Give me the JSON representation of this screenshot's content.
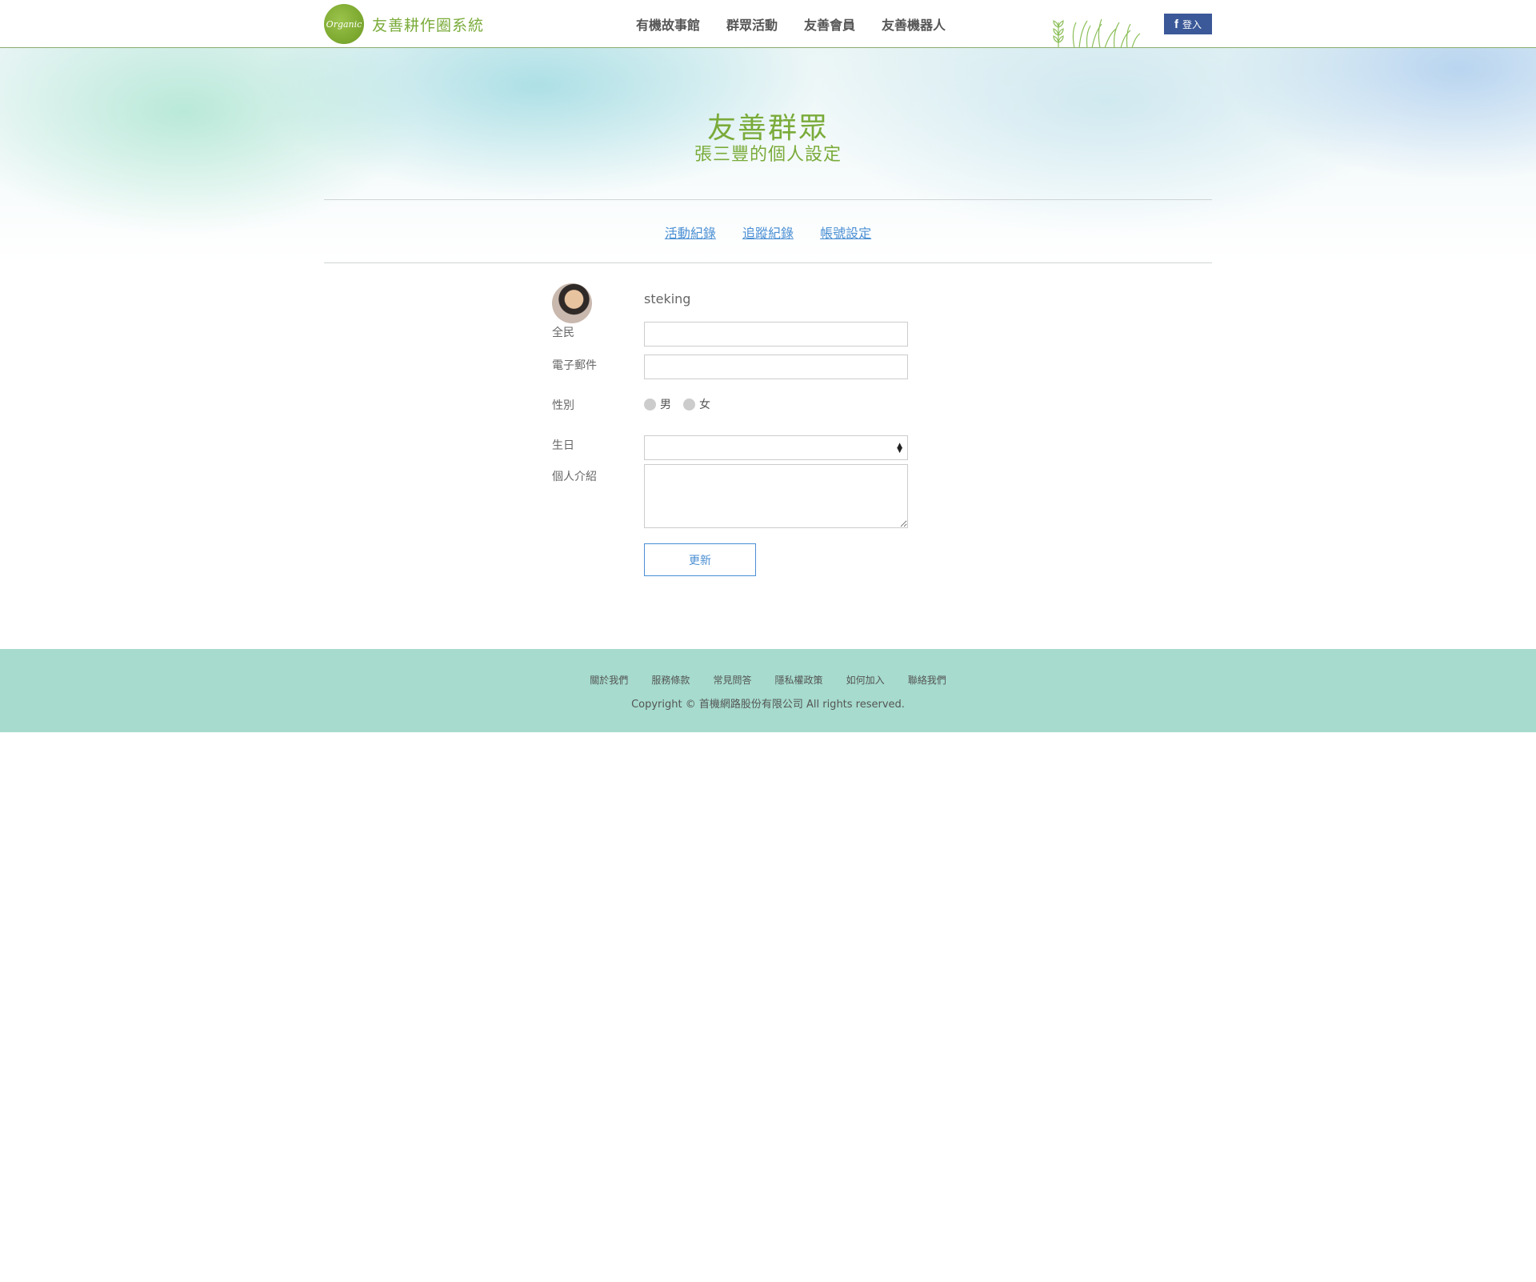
{
  "header": {
    "logo_text": "Organic",
    "site_name": "友善耕作圈系統",
    "nav": [
      "有機故事館",
      "群眾活動",
      "友善會員",
      "友善機器人"
    ],
    "fb_login_label": "登入"
  },
  "hero": {
    "title": "友善群眾",
    "subtitle": "張三豐的個人設定",
    "tabs": [
      "活動紀錄",
      "追蹤紀錄",
      "帳號設定"
    ]
  },
  "profile": {
    "username": "steking",
    "name_label": "全民",
    "name_value": "",
    "email_label": "電子郵件",
    "email_value": "",
    "gender_label": "性別",
    "gender_options": [
      "男",
      "女"
    ],
    "birthday_label": "生日",
    "birthday_value": "",
    "bio_label": "個人介紹",
    "bio_value": "",
    "update_label": "更新"
  },
  "footer": {
    "links": [
      "關於我們",
      "服務條款",
      "常見問答",
      "隱私權政策",
      "如何加入",
      "聯絡我們"
    ],
    "copyright": "Copyright © 首機網路股份有限公司 All rights reserved."
  },
  "colors": {
    "brand_green": "#7aab3a",
    "link_blue": "#4a8fd3",
    "facebook_blue": "#3b5998",
    "footer_bg": "#a6dbcd"
  }
}
